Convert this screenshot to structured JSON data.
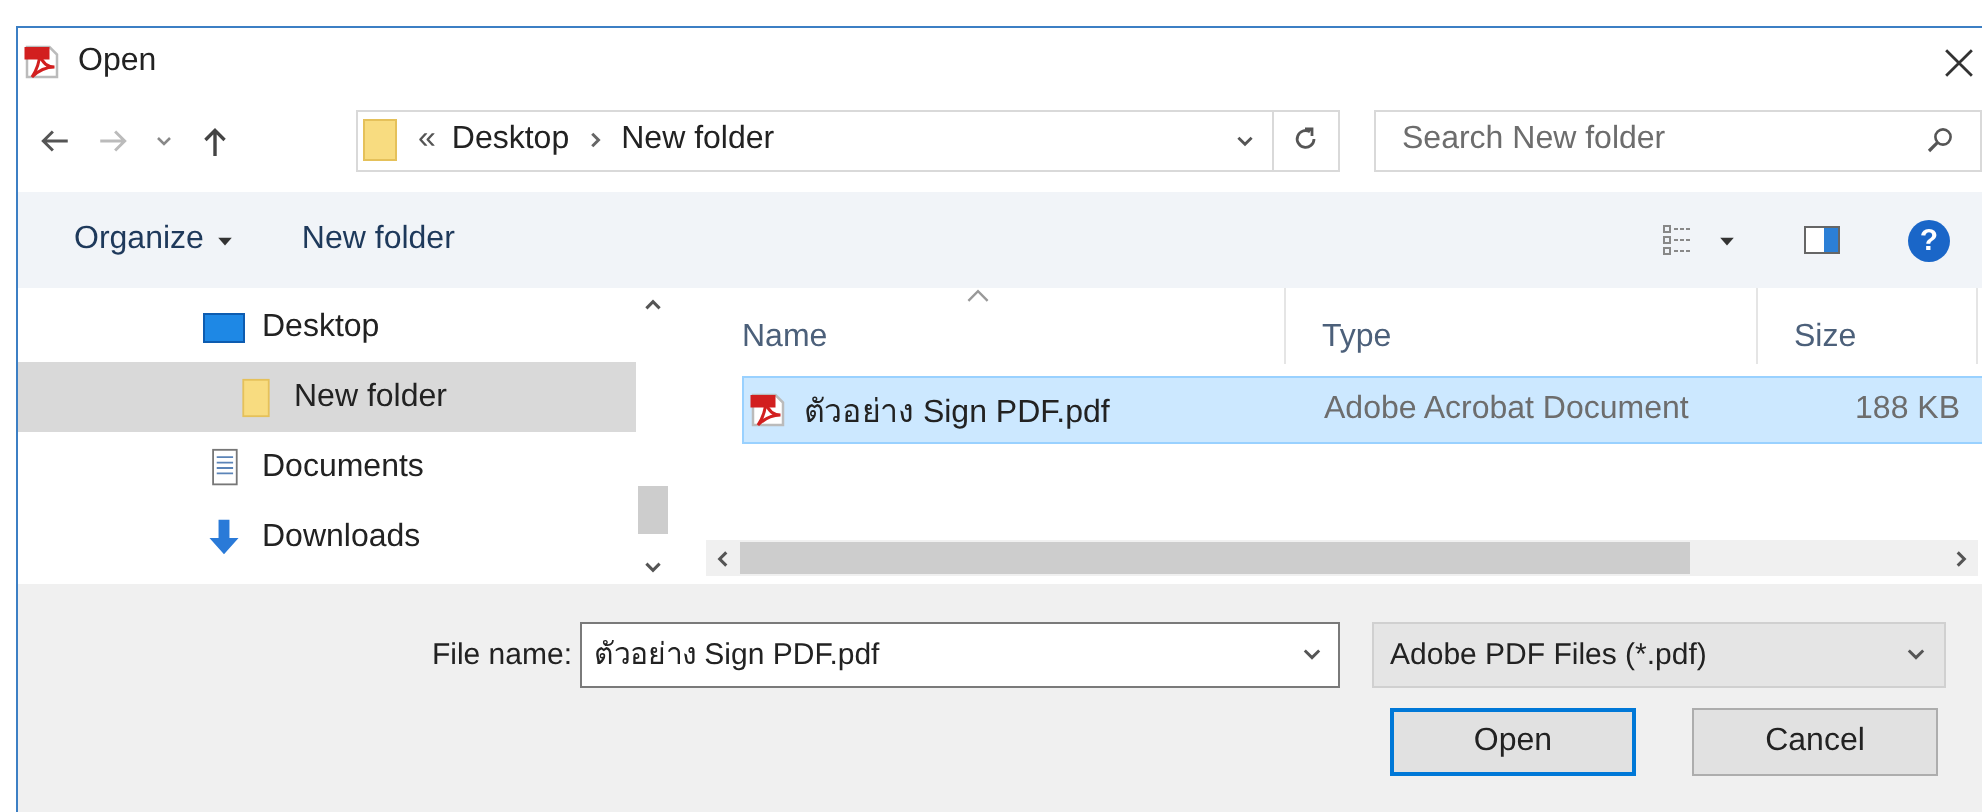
{
  "window": {
    "title": "Open"
  },
  "address": {
    "overflow_marker": "«",
    "crumbs": [
      "Desktop",
      "New folder"
    ]
  },
  "search": {
    "placeholder": "Search New folder"
  },
  "toolbar": {
    "items": [
      {
        "label": "Organize",
        "dropdown": true
      },
      {
        "label": "New folder",
        "dropdown": false
      }
    ],
    "help_glyph": "?"
  },
  "sidebar": {
    "items": [
      {
        "label": "Desktop",
        "kind": "desktop",
        "selected": false,
        "children": [
          {
            "label": "New folder",
            "kind": "folder",
            "selected": true
          }
        ]
      },
      {
        "label": "Documents",
        "kind": "documents",
        "selected": false
      },
      {
        "label": "Downloads",
        "kind": "downloads",
        "selected": false
      }
    ]
  },
  "table": {
    "columns": [
      {
        "label": "Name",
        "sorted": true
      },
      {
        "label": "Type",
        "sorted": false
      },
      {
        "label": "Size",
        "sorted": false
      }
    ],
    "rows": [
      {
        "cells": [
          "ตัวอย่าง Sign PDF.pdf",
          "Adobe Acrobat Document",
          "188 KB"
        ],
        "selected": true
      }
    ]
  },
  "file_name": {
    "label": "File name:",
    "value": "ตัวอย่าง Sign PDF.pdf"
  },
  "file_type": {
    "value": "Adobe PDF Files (*.pdf)"
  },
  "buttons": [
    {
      "label": "Open",
      "default": true
    },
    {
      "label": "Cancel",
      "default": false
    }
  ]
}
